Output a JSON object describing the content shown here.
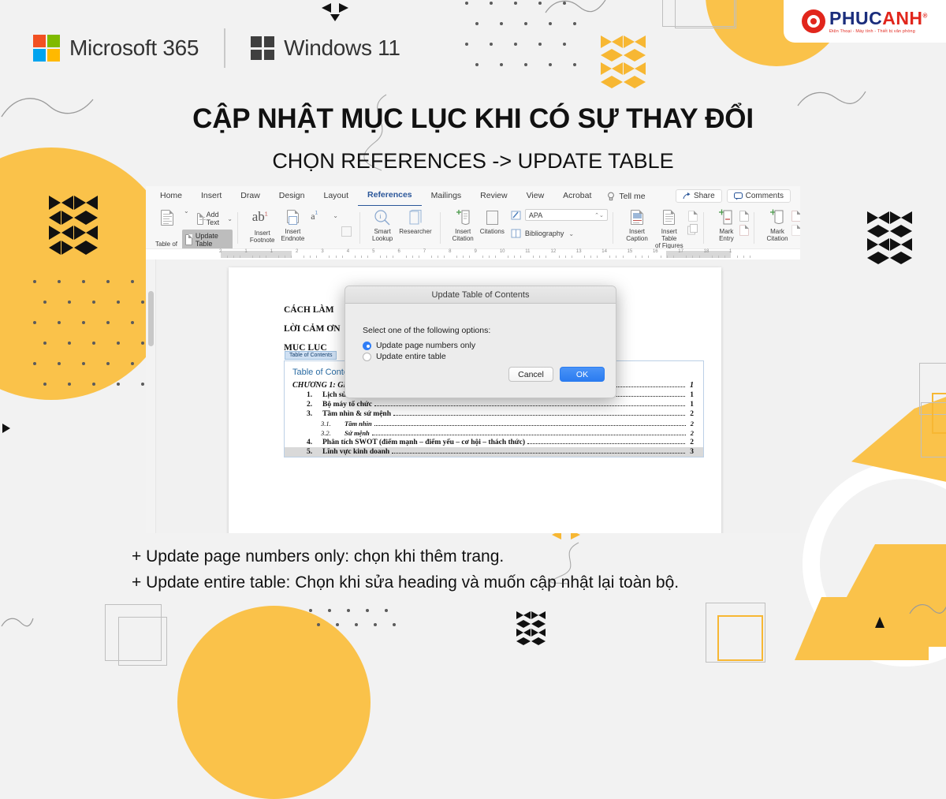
{
  "brand": {
    "microsoft_label": "Microsoft 365",
    "windows_label": "Windows 11",
    "phucanh_name_1": "PHUC",
    "phucanh_name_2": "ANH",
    "phucanh_tagline": "Điện Thoại - Máy tính - Thiết bị văn phòng",
    "registered_mark": "®",
    "accent_yellow": "#fac24a",
    "ms_red": "#f25022",
    "ms_green": "#7fba00",
    "ms_blue": "#00a4ef",
    "ms_yellow": "#ffb900",
    "word_blue": "#2b579a"
  },
  "headline": {
    "title": "CẬP NHẬT MỤC LỤC KHI CÓ SỰ THAY ĐỔI",
    "subtitle": "CHỌN REFERENCES -> UPDATE TABLE"
  },
  "word": {
    "tabs": [
      {
        "label": "Home",
        "active": false
      },
      {
        "label": "Insert",
        "active": false
      },
      {
        "label": "Draw",
        "active": false
      },
      {
        "label": "Design",
        "active": false
      },
      {
        "label": "Layout",
        "active": false
      },
      {
        "label": "References",
        "active": true
      },
      {
        "label": "Mailings",
        "active": false
      },
      {
        "label": "Review",
        "active": false
      },
      {
        "label": "View",
        "active": false
      },
      {
        "label": "Acrobat",
        "active": false
      }
    ],
    "tell_me": "Tell me",
    "share": "Share",
    "comments": "Comments",
    "ribbon": {
      "table_of_contents": "Table of\nContents",
      "add_text": "Add Text",
      "update_table": "Update Table",
      "insert_footnote": "Insert\nFootnote",
      "insert_endnote": "Insert\nEndnote",
      "smart_lookup": "Smart\nLookup",
      "researcher": "Researcher",
      "insert_citation": "Insert\nCitation",
      "citations": "Citations",
      "style_value": "APA",
      "bibliography": "Bibliography",
      "insert_caption": "Insert\nCaption",
      "insert_table_of_figures": "Insert Table\nof Figures",
      "mark_entry": "Mark\nEntry",
      "mark_citation": "Mark\nCitation"
    },
    "ruler_numbers": [
      "2",
      "1",
      "1",
      "2",
      "3",
      "4",
      "5",
      "6",
      "7",
      "8",
      "9",
      "10",
      "11",
      "12",
      "13",
      "14",
      "15",
      "16",
      "17",
      "18",
      "1"
    ]
  },
  "document": {
    "heading_lines": [
      "CÁCH LÀM",
      "LỜI CẢM ƠN",
      "MỤC LỤC"
    ],
    "toc_tag": "Table of Contents",
    "toc_heading": "Table of Contents",
    "entries": [
      {
        "level": 0,
        "index": "",
        "text": "CHƯƠNG 1: GIỚI THIỆU VỀ DOANH NGHIỆP THỰC TẬP",
        "page": "1"
      },
      {
        "level": 1,
        "index": "1.",
        "text": "Lịch sử hình thành",
        "page": "1"
      },
      {
        "level": 1,
        "index": "2.",
        "text": "Bộ máy tổ chức",
        "page": "1"
      },
      {
        "level": 1,
        "index": "3.",
        "text": "Tầm nhìn & sứ mệnh",
        "page": "2"
      },
      {
        "level": 2,
        "index": "3.1.",
        "text": "Tầm nhìn",
        "page": "2"
      },
      {
        "level": 2,
        "index": "3.2.",
        "text": "Sứ mệnh",
        "page": "2"
      },
      {
        "level": 1,
        "index": "4.",
        "text": "Phân tích SWOT (điểm mạnh – điểm yếu – cơ hội – thách thức)",
        "page": "2"
      },
      {
        "level": 1,
        "index": "5.",
        "text": "Lĩnh vực kinh doanh",
        "page": "3"
      }
    ]
  },
  "dialog": {
    "title": "Update Table of Contents",
    "prompt": "Select one of the following options:",
    "options": [
      {
        "label": "Update page numbers only",
        "selected": true
      },
      {
        "label": "Update entire table",
        "selected": false
      }
    ],
    "cancel": "Cancel",
    "ok": "OK"
  },
  "captions": {
    "line1": "+ Update page numbers only: chọn khi thêm trang.",
    "line2": "+ Update entire table: Chọn khi sửa heading và muốn cập nhật lại toàn bộ."
  }
}
